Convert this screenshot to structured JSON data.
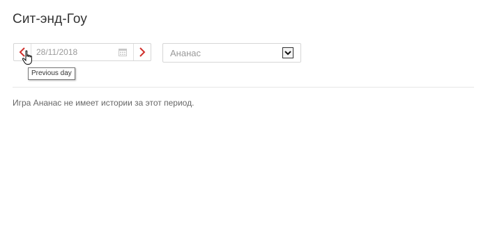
{
  "page": {
    "title": "Сит-энд-Гоу"
  },
  "date_picker": {
    "value": "28/11/2018",
    "prev_icon": "chevron-left-icon",
    "next_icon": "chevron-right-icon",
    "calendar_icon": "calendar-icon",
    "tooltip": "Previous day"
  },
  "game_select": {
    "selected": "Ананас",
    "arrow_icon": "dropdown-arrow-icon"
  },
  "message": "Игра Ананас не имеет истории за этот период.",
  "colors": {
    "accent": "#d0312d",
    "text": "#333333",
    "muted": "#9a9a9a",
    "border": "#d6d6d6"
  }
}
